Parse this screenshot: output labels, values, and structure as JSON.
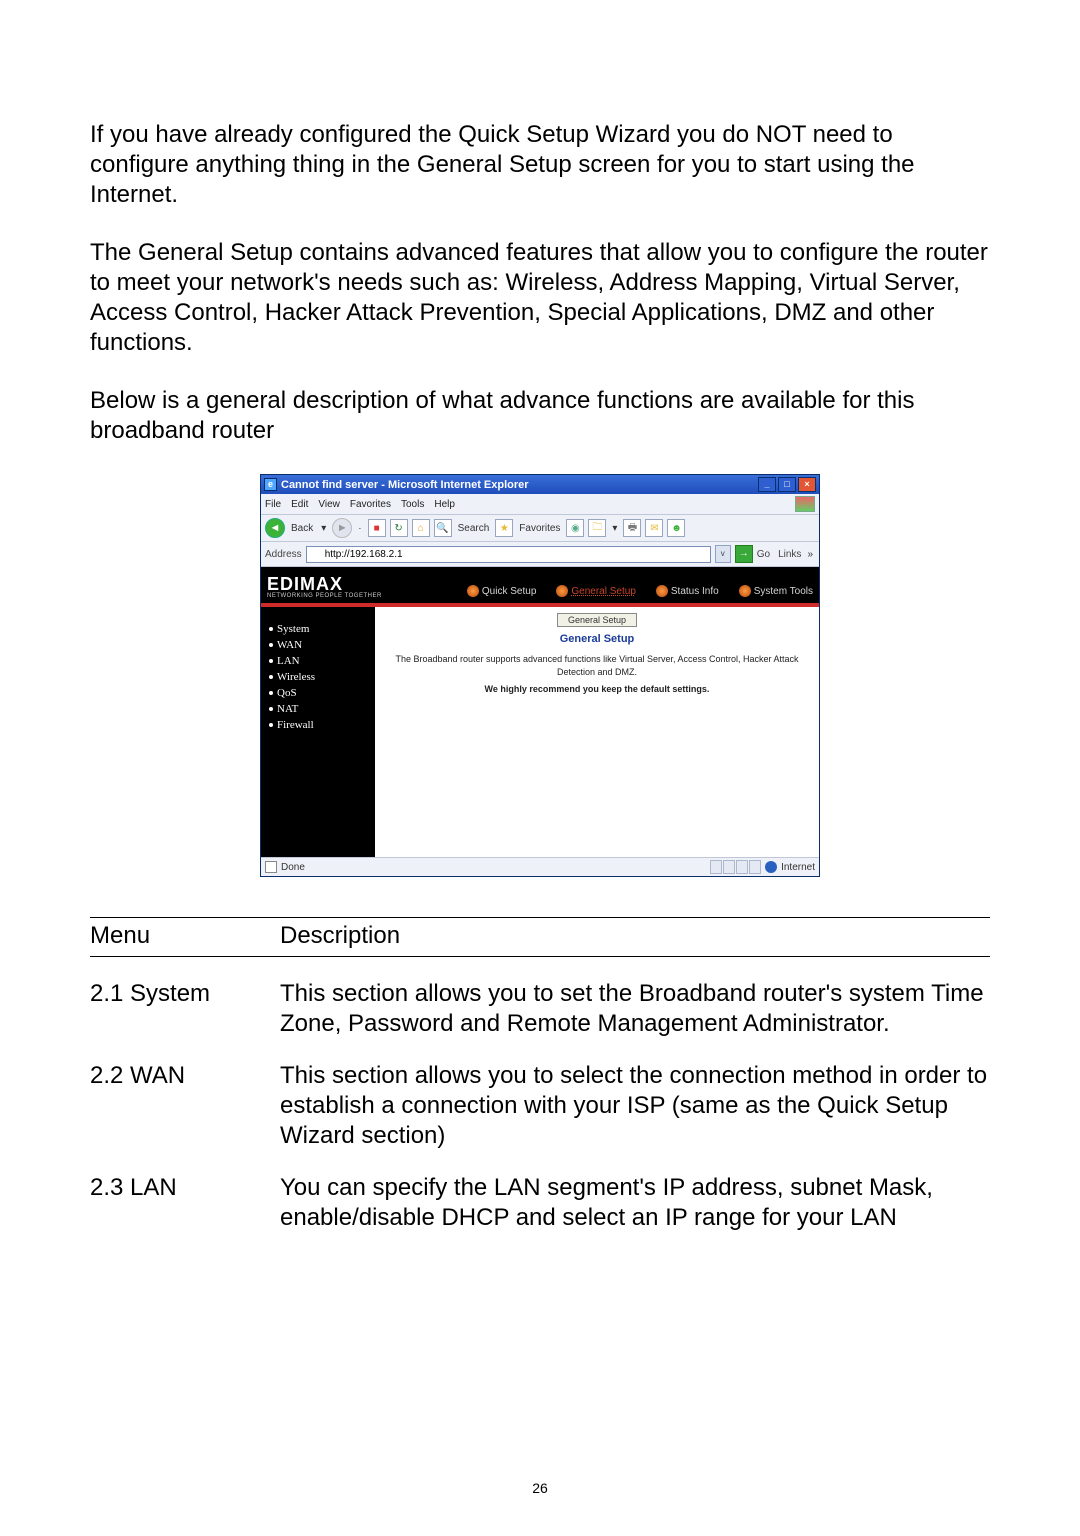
{
  "paragraphs": {
    "p1": "If you have already configured the Quick Setup Wizard you do NOT need to configure anything thing in the General Setup screen for you to start using the Internet.",
    "p2": "The General Setup contains advanced features that allow you to configure the router to meet your network's needs such as: Wireless, Address Mapping, Virtual Server, Access Control, Hacker Attack Prevention, Special Applications, DMZ and other functions.",
    "p3": "Below is a general description of what advance functions are available for this broadband router"
  },
  "ie": {
    "title": "Cannot find server - Microsoft Internet Explorer",
    "menus": [
      "File",
      "Edit",
      "View",
      "Favorites",
      "Tools",
      "Help"
    ],
    "back_label": "Back",
    "search_label": "Search",
    "favorites_label": "Favorites",
    "address_label": "Address",
    "address_value": "http://192.168.2.1",
    "go_label": "Go",
    "links_label": "Links",
    "status_left": "Done",
    "status_zone": "Internet"
  },
  "router": {
    "brand": "EDIMAX",
    "tagline": "NETWORKING PEOPLE TOGETHER",
    "topnav": [
      {
        "label": "Quick Setup",
        "active": false
      },
      {
        "label": "General Setup",
        "active": true
      },
      {
        "label": "Status Info",
        "active": false
      },
      {
        "label": "System Tools",
        "active": false
      }
    ],
    "sidebar": [
      "System",
      "WAN",
      "LAN",
      "Wireless",
      "QoS",
      "NAT",
      "Firewall"
    ],
    "crumb": "General Setup",
    "panel_title": "General Setup",
    "panel_text": "The Broadband router supports advanced functions like Virtual Server, Access Control, Hacker Attack Detection and DMZ.",
    "panel_bold": "We highly recommend you keep the default settings."
  },
  "table": {
    "headers": {
      "menu": "Menu",
      "desc": "Description"
    },
    "rows": [
      {
        "menu": "2.1 System",
        "desc": "This section allows you to set the Broadband router's system Time Zone, Password and Remote Management Administrator."
      },
      {
        "menu": "2.2 WAN",
        "desc": "This section allows you to select the connection method in order to establish a connection with your ISP (same as the Quick Setup Wizard section)"
      },
      {
        "menu": "2.3 LAN",
        "desc": "You can specify the LAN segment's IP address, subnet Mask, enable/disable DHCP and select an IP range for your LAN"
      }
    ]
  },
  "page_number": "26"
}
